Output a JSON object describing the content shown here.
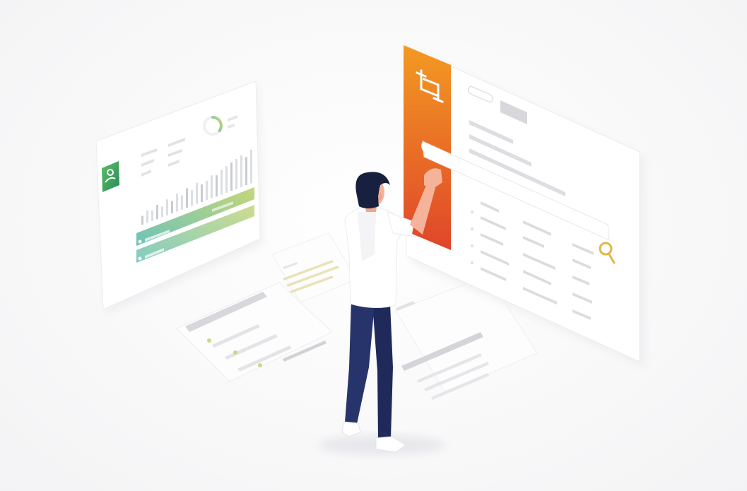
{
  "illustration": {
    "theme": "isometric-dashboard-illustration",
    "colors": {
      "background": "#f7f7f8",
      "panel": "#ffffff",
      "panel_shadow": "#e9e9ec",
      "placeholder_bar": "#d9d9dd",
      "placeholder_bar_light": "#e6e6ea",
      "accent_orange": "#f08a1c",
      "accent_red": "#e0452a",
      "accent_green": "#2e9b5b",
      "accent_teal": "#6cc3b8",
      "accent_lime": "#c5d67a",
      "accent_gold": "#e3b54a",
      "person_shirt": "#ffffff",
      "person_pants": "#1f2a5a",
      "person_hair": "#17213f",
      "person_skin": "#f5b39a",
      "shoes": "#ffffff"
    },
    "icons": {
      "left_panel_app_icon": "user-avatar-icon",
      "right_panel_logo": "crop-frame-icon",
      "search": "search-icon",
      "gauge": "progress-ring-icon"
    },
    "left_panel": {
      "gauge_fraction": 0.35,
      "histogram_levels": [
        0.25,
        0.35,
        0.3,
        0.4,
        0.3,
        0.45,
        0.35,
        0.5,
        0.4,
        0.55,
        0.45,
        0.6,
        0.5,
        0.55,
        0.65,
        0.6,
        0.7,
        0.75,
        0.8,
        0.85,
        0.9,
        0.8,
        0.95
      ]
    }
  }
}
